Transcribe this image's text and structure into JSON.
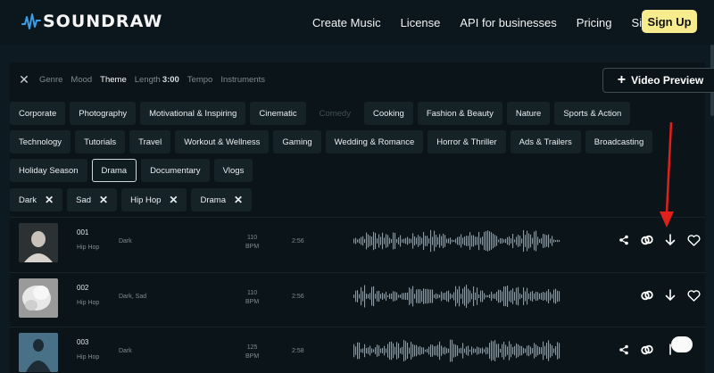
{
  "header": {
    "brand": "SOUNDRAW",
    "nav": [
      "Create Music",
      "License",
      "API for businesses",
      "Pricing",
      "Sign in"
    ],
    "signup_label": "Sign Up"
  },
  "filterbar": {
    "tabs": [
      {
        "label": "Genre",
        "active": false
      },
      {
        "label": "Mood",
        "active": false
      },
      {
        "label": "Theme",
        "active": true
      },
      {
        "label": "Length",
        "active": false
      },
      {
        "label": "Tempo",
        "active": false
      },
      {
        "label": "Instruments",
        "active": false
      }
    ],
    "length_value": "3:00",
    "video_preview_label": "Video Preview"
  },
  "themes": {
    "row1": [
      "Corporate",
      "Photography",
      "Motivational & Inspiring",
      "Cinematic",
      "Comedy",
      "Cooking",
      "Fashion & Beauty",
      "Nature",
      "Sports & Action"
    ],
    "row2": [
      "Technology",
      "Tutorials",
      "Travel",
      "Workout & Wellness",
      "Gaming",
      "Wedding & Romance",
      "Horror & Thriller",
      "Ads & Trailers",
      "Broadcasting"
    ],
    "row3": [
      "Holiday Season",
      "Drama",
      "Documentary",
      "Vlogs"
    ],
    "disabled": "Comedy",
    "selected": "Drama"
  },
  "active_tags": [
    "Dark",
    "Sad",
    "Hip Hop",
    "Drama"
  ],
  "tracks": [
    {
      "num": "001",
      "genre": "Hip Hop",
      "mood": "Dark",
      "bpm": "110",
      "bpm_unit": "BPM",
      "length": "2:56"
    },
    {
      "num": "002",
      "genre": "Hip Hop",
      "mood": "Dark, Sad",
      "bpm": "110",
      "bpm_unit": "BPM",
      "length": "2:56"
    },
    {
      "num": "003",
      "genre": "Hip Hop",
      "mood": "Dark",
      "bpm": "125",
      "bpm_unit": "BPM",
      "length": "2:58"
    }
  ],
  "colors": {
    "background": "#0d1a21",
    "accent_yellow": "#f6ec8e",
    "annotation_red": "#e0201c",
    "logo_blue": "#3b9ee6"
  },
  "icons": [
    "close-icon",
    "plus-icon",
    "share-icon",
    "link-icon",
    "download-icon",
    "heart-icon",
    "chat-icon"
  ]
}
